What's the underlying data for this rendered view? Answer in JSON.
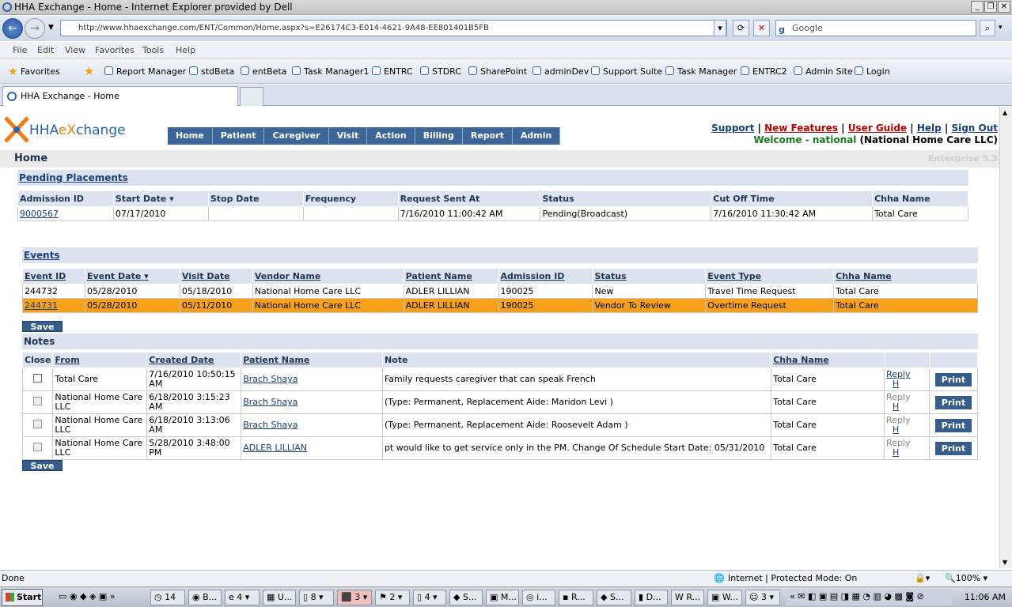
{
  "window": {
    "title": "HHA Exchange - Home - Internet Explorer provided by Dell"
  },
  "address": {
    "url": "http://www.hhaexchange.com/ENT/Common/Home.aspx?s=E26174C3-E014-4621-9A48-EE801401B5FB",
    "search_placeholder": "Google"
  },
  "menu": [
    "File",
    "Edit",
    "View",
    "Favorites",
    "Tools",
    "Help"
  ],
  "favorites": {
    "label": "Favorites",
    "items": [
      "Report Manager",
      "stdBeta",
      "entBeta",
      "Task Manager1",
      "ENTRC",
      "STDRC",
      "SharePoint",
      "adminDev",
      "Support Suite",
      "Task Manager",
      "ENTRC2",
      "Admin Site",
      "Login"
    ]
  },
  "tab": {
    "label": "HHA Exchange - Home"
  },
  "app": {
    "logo_a": "HHA",
    "logo_b": "eX",
    "logo_c": "change",
    "nav": [
      "Home",
      "Patient",
      "Caregiver",
      "Visit",
      "Action",
      "Billing",
      "Report",
      "Admin"
    ],
    "links": {
      "support": "Support",
      "new_features": "New Features",
      "user_guide": "User Guide",
      "help": "Help",
      "sign_out": "Sign Out"
    },
    "welcome_label": "Welcome - national",
    "welcome_org": "(National Home Care LLC)",
    "page_title": "Home",
    "edition": "Enterprise 5.3"
  },
  "pending": {
    "title": "Pending Placements",
    "columns": [
      "Admission ID",
      "Start Date",
      "Stop Date",
      "Frequency",
      "Request Sent At",
      "Status",
      "Cut Off Time",
      "Chha Name"
    ],
    "rows": [
      [
        "9000567",
        "07/17/2010",
        "",
        "",
        "7/16/2010 11:00:42 AM",
        "Pending(Broadcast)",
        "7/16/2010 11:30:42 AM",
        "Total Care"
      ]
    ]
  },
  "events": {
    "title": "Events",
    "columns": [
      "Event ID",
      "Event Date",
      "Visit Date",
      "Vendor Name",
      "Patient Name",
      "Admission ID",
      "Status",
      "Event Type",
      "Chha Name"
    ],
    "rows": [
      [
        "244732",
        "05/28/2010",
        "05/18/2010",
        "National Home Care LLC",
        "ADLER LILLIAN",
        "190025",
        "New",
        "Travel Time Request",
        "Total Care"
      ],
      [
        "244731",
        "05/28/2010",
        "05/11/2010",
        "National Home Care LLC",
        "ADLER LILLIAN",
        "190025",
        "Vendor To Review",
        "Overtime Request",
        "Total Care"
      ]
    ],
    "save_label": "Save"
  },
  "notes": {
    "title": "Notes",
    "columns": [
      "Close",
      "From",
      "Created Date",
      "Patient Name",
      "Note",
      "Chha Name",
      "",
      ""
    ],
    "rows": [
      {
        "from": "Total Care",
        "created": "7/16/2010 10:50:15 AM",
        "patient": "Brach Shaya",
        "note": "Family requests caregiver that can speak French",
        "chha": "Total Care",
        "reply": "Reply",
        "h": "H",
        "print": "Print"
      },
      {
        "from": "National Home Care LLC",
        "created": "6/18/2010 3:15:23 AM",
        "patient": "Brach Shaya",
        "note": "(Type: Permanent, Replacement Aide: Maridon Levi )",
        "chha": "Total Care",
        "reply": "Reply",
        "h": "H",
        "print": "Print"
      },
      {
        "from": "National Home Care LLC",
        "created": "6/18/2010 3:13:06 AM",
        "patient": "Brach Shaya",
        "note": "(Type: Permanent, Replacement Aide: Roosevelt Adam )",
        "chha": "Total Care",
        "reply": "Reply",
        "h": "H",
        "print": "Print"
      },
      {
        "from": "National Home Care LLC",
        "created": "5/28/2010 3:48:00 PM",
        "patient": "ADLER LILLIAN",
        "note": "pt would like to get service only in the PM. Change Of Schedule Start Date: 05/31/2010",
        "chha": "Total Care",
        "reply": "Reply",
        "h": "H",
        "print": "Print"
      }
    ],
    "save_label": "Save"
  },
  "status": {
    "left": "Done",
    "zone": "Internet | Protected Mode: On",
    "zoom": "100%"
  },
  "taskbar": {
    "start": "Start",
    "items": [
      "14",
      "B...",
      "4",
      "U...",
      "8",
      "3",
      "2",
      "4",
      "S...",
      "M...",
      "i...",
      "R...",
      "S...",
      "D...",
      "R...",
      "W...",
      "3"
    ],
    "clock": "11:06 AM"
  }
}
